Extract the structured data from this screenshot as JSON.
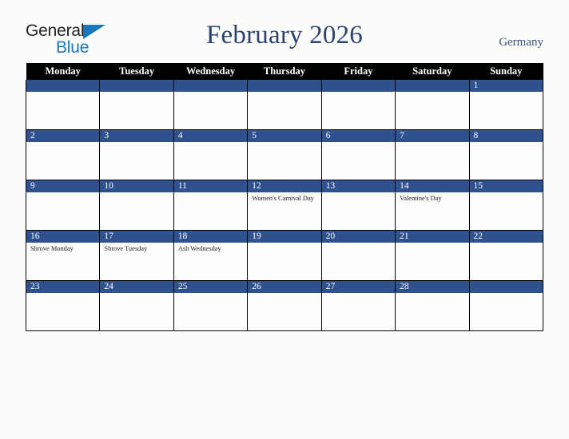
{
  "brand": {
    "logo_line1": "General",
    "logo_line2": "Blue",
    "triangle_icon": "triangle-icon",
    "logo_dark_color": "#231f20",
    "logo_blue_color": "#1878be"
  },
  "header": {
    "title": "February 2026",
    "country": "Germany",
    "title_color": "#2b4270",
    "country_color": "#3a4f7a"
  },
  "theme": {
    "page_background": "#fcfcfa",
    "weekday_header_background": "#000000",
    "weekday_header_text": "#ffffff",
    "day_bar_background": "#2f5190",
    "day_bar_text": "#ffffff",
    "cell_background": "#fdfdfd",
    "grid_line": "#000000"
  },
  "calendar": {
    "month": "February",
    "year": "2026",
    "weekdays": [
      "Monday",
      "Tuesday",
      "Wednesday",
      "Thursday",
      "Friday",
      "Saturday",
      "Sunday"
    ],
    "weeks": [
      [
        {
          "day": "",
          "events": []
        },
        {
          "day": "",
          "events": []
        },
        {
          "day": "",
          "events": []
        },
        {
          "day": "",
          "events": []
        },
        {
          "day": "",
          "events": []
        },
        {
          "day": "",
          "events": []
        },
        {
          "day": "1",
          "events": []
        }
      ],
      [
        {
          "day": "2",
          "events": []
        },
        {
          "day": "3",
          "events": []
        },
        {
          "day": "4",
          "events": []
        },
        {
          "day": "5",
          "events": []
        },
        {
          "day": "6",
          "events": []
        },
        {
          "day": "7",
          "events": []
        },
        {
          "day": "8",
          "events": []
        }
      ],
      [
        {
          "day": "9",
          "events": []
        },
        {
          "day": "10",
          "events": []
        },
        {
          "day": "11",
          "events": []
        },
        {
          "day": "12",
          "events": [
            "Women's Carnival Day"
          ]
        },
        {
          "day": "13",
          "events": []
        },
        {
          "day": "14",
          "events": [
            "Valentine's Day"
          ]
        },
        {
          "day": "15",
          "events": []
        }
      ],
      [
        {
          "day": "16",
          "events": [
            "Shrove Monday"
          ]
        },
        {
          "day": "17",
          "events": [
            "Shrove Tuesday"
          ]
        },
        {
          "day": "18",
          "events": [
            "Ash Wednesday"
          ]
        },
        {
          "day": "19",
          "events": []
        },
        {
          "day": "20",
          "events": []
        },
        {
          "day": "21",
          "events": []
        },
        {
          "day": "22",
          "events": []
        }
      ],
      [
        {
          "day": "23",
          "events": []
        },
        {
          "day": "24",
          "events": []
        },
        {
          "day": "25",
          "events": []
        },
        {
          "day": "26",
          "events": []
        },
        {
          "day": "27",
          "events": []
        },
        {
          "day": "28",
          "events": []
        },
        {
          "day": "",
          "events": []
        }
      ]
    ]
  }
}
